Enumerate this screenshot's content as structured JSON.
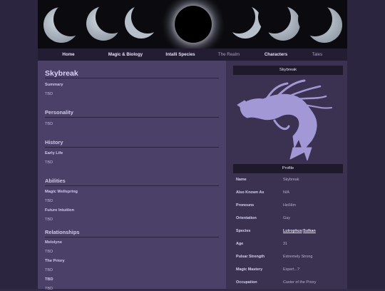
{
  "nav": [
    "Home",
    "Magic & Biology",
    "Intalli Species",
    "The Realm",
    "Characters",
    "Tales"
  ],
  "page": {
    "title": "Skybreak",
    "summary_label": "Summary",
    "summary_text": "TBD",
    "personality_heading": "Personality",
    "personality_text": "TBD",
    "history_heading": "History",
    "early_life_label": "Early Life",
    "early_life_text": "TBD",
    "abilities_heading": "Abilities",
    "magic_wellspring_label": "Magic Wellspring",
    "magic_wellspring_text": "TBD",
    "future_intuition_label": "Future Intuition",
    "future_intuition_text": "TBD",
    "relationships_heading": "Relationships",
    "melolyne_label": "Melolyne",
    "melolyne_text": "TBD",
    "priory_label": "The Priory",
    "priory_text": "TBD",
    "tbd_label": "TBD",
    "tbd_text": "TBD"
  },
  "infobox": {
    "name_header": "Skybreak",
    "profile_header": "Profile",
    "rows": [
      {
        "label": "Name",
        "value": "Skybreak"
      },
      {
        "label": "Also Known As",
        "value": "N/A"
      },
      {
        "label": "Pronouns",
        "value": "He/Him"
      },
      {
        "label": "Orientation",
        "value": "Gay"
      },
      {
        "label": "Species",
        "value_link1": "Lutrophus",
        "value_sep": "/",
        "value_link2": "Sulkan"
      },
      {
        "label": "Age",
        "value": "31"
      },
      {
        "label": "Pulsar Strength",
        "value": "Extremely Strong"
      },
      {
        "label": "Magic Mastery",
        "value": "Expert...?"
      },
      {
        "label": "Occupation",
        "value": "Caster of the Priory"
      }
    ]
  }
}
